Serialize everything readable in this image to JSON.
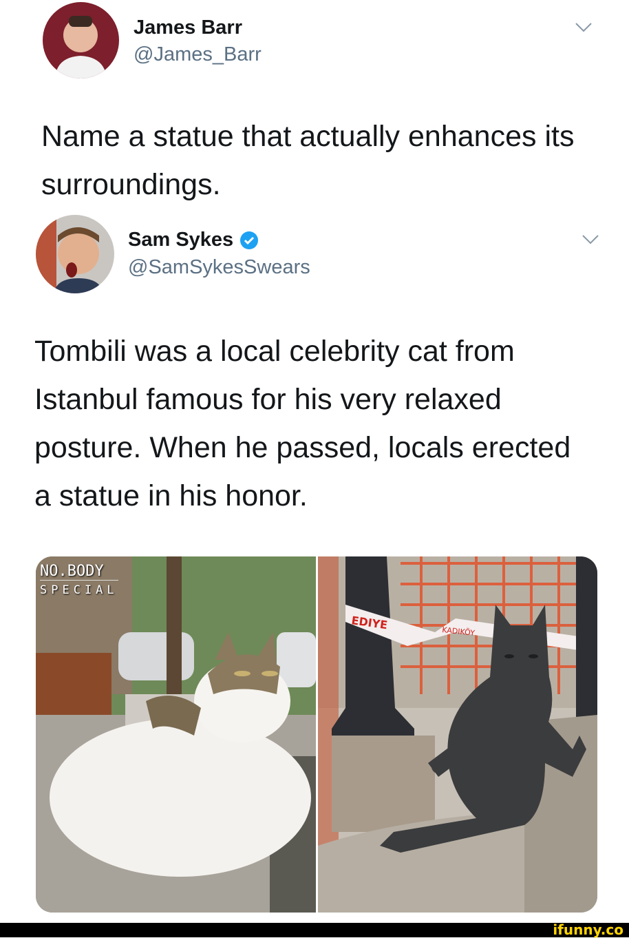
{
  "tweet1": {
    "name": "James Barr",
    "handle": "@James_Barr",
    "text": "Name a statue that actually enhances its surroundings."
  },
  "tweet2": {
    "name": "Sam Sykes",
    "handle": "@SamSykesSwears",
    "verified": true,
    "text": "Tombili was a local celebrity cat from Istanbul famous for his very relaxed posture. When he passed, locals erected a statue in his honor."
  },
  "media": {
    "left_watermark_line1": "NO.BODY",
    "left_watermark_line2": "SPECIAL",
    "banner_text": "EDIYE",
    "tape_text": "KADIKÖY"
  },
  "watermark": "ifunny.co",
  "colors": {
    "verified": "#1da1f2",
    "handle": "#5b7083",
    "ifunny": "#ffd400"
  }
}
